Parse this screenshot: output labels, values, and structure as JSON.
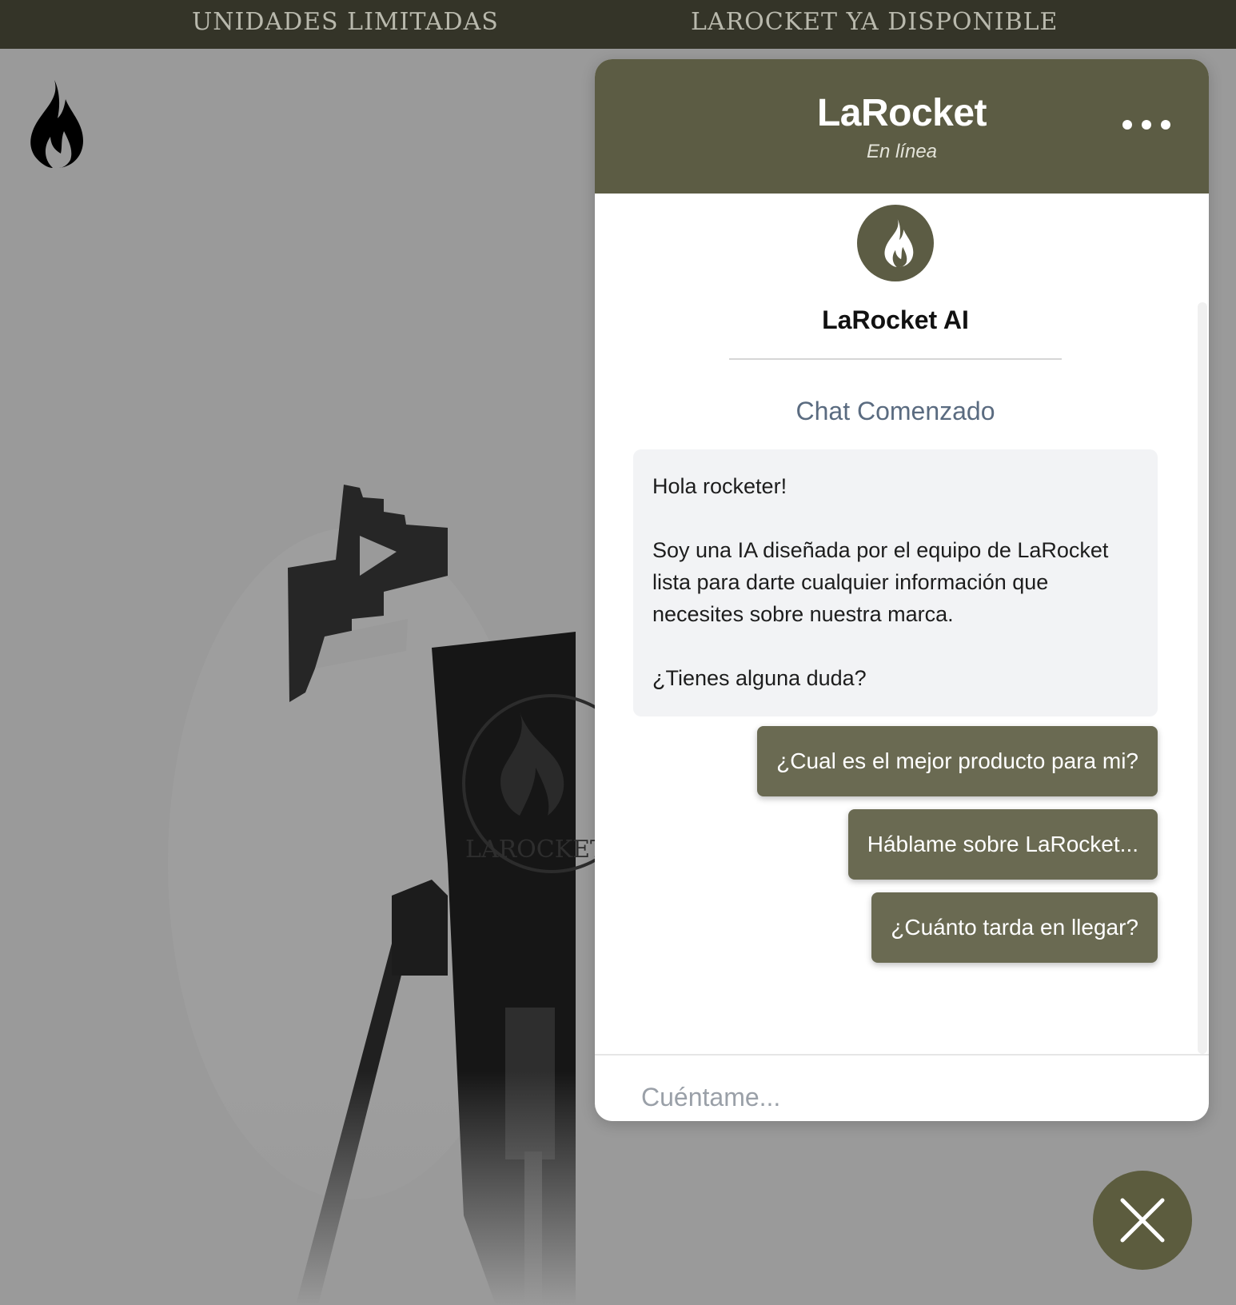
{
  "announcement_bar": {
    "messages": [
      "UNIDADES LIMITADAS",
      "LAROCKET YA DISPONIBLE"
    ]
  },
  "site": {
    "logo_icon": "flame-icon",
    "hero_image": "camping-stove-product-photo"
  },
  "chat": {
    "header": {
      "title": "LaRocket",
      "status": "En línea",
      "menu_icon": "more-horizontal-icon"
    },
    "bot": {
      "avatar_icon": "flame-icon",
      "name": "LaRocket AI"
    },
    "started_label": "Chat Comenzado",
    "welcome_message": {
      "greeting": "Hola rocketer!",
      "body": "Soy una IA diseñada por el equipo de LaRocket lista para darte cualquier información que necesites sobre nuestra marca.",
      "question": "¿Tienes alguna duda?"
    },
    "suggestions": [
      "¿Cual es el mejor producto para mi?",
      "Háblame sobre LaRocket...",
      "¿Cuánto tarda en llegar?"
    ],
    "input": {
      "placeholder": "Cuéntame...",
      "value": ""
    },
    "close_icon": "close-icon"
  },
  "colors": {
    "brand": "#5c5c44",
    "suggestion_button": "#6a6a52",
    "announcement_bar": "#343428",
    "overlay": "#9a9a9a"
  }
}
